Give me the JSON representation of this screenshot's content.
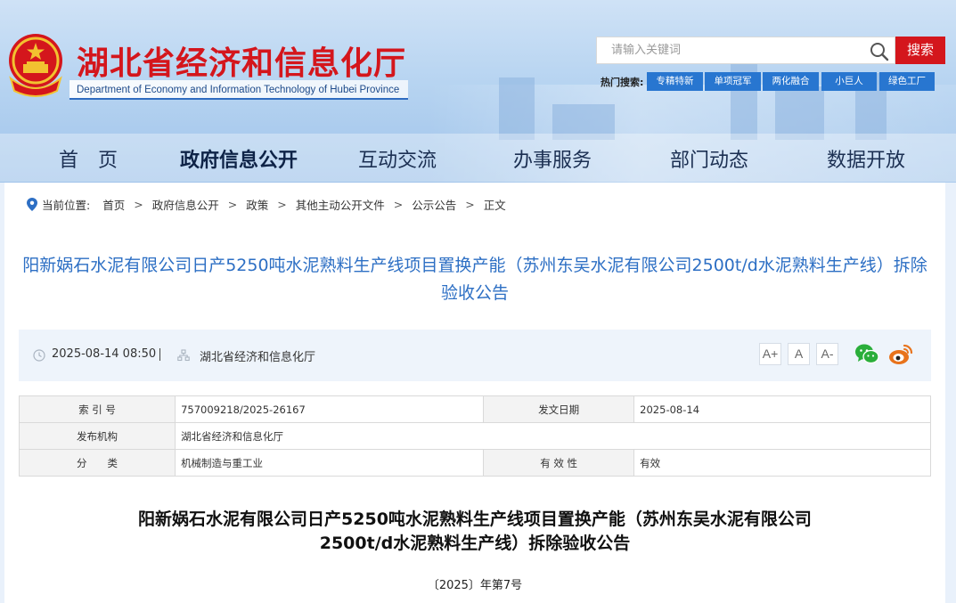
{
  "header": {
    "site_title": "湖北省经济和信息化厅",
    "site_subtitle": "Department of Economy and Information Technology of Hubei Province",
    "search_placeholder": "请输入关键词",
    "search_button": "搜索",
    "hot_search_label": "热门搜索:",
    "hot_tags": [
      "专精特新",
      "单项冠军",
      "两化融合",
      "小巨人",
      "绿色工厂"
    ]
  },
  "nav": {
    "items": [
      "首　页",
      "政府信息公开",
      "互动交流",
      "办事服务",
      "部门动态",
      "数据开放"
    ],
    "active": "政府信息公开"
  },
  "breadcrumb": {
    "label": "当前位置:",
    "items": [
      "首页",
      "政府信息公开",
      "政策",
      "其他主动公开文件",
      "公示公告",
      "正文"
    ],
    "separator": ">"
  },
  "article": {
    "title": "阳新娲石水泥有限公司日产5250吨水泥熟料生产线项目置换产能（苏州东吴水泥有限公司2500t/d水泥熟料生产线）拆除验收公告",
    "date": "2025-08-14 08:50",
    "source": "湖北省经济和信息化厅",
    "font_buttons": [
      "A+",
      "A",
      "A-"
    ],
    "doc_title_line1": "阳新娲石水泥有限公司日产5250吨水泥熟料生产线项目置换产能（苏州东吴水泥有限公司",
    "doc_title_line2": "2500t/d水泥熟料生产线）拆除验收公告",
    "doc_number": "〔2025〕年第7号"
  },
  "info_table": {
    "index_label": "索 引 号",
    "index_value": "757009218/2025-26167",
    "date_label": "发文日期",
    "date_value": "2025-08-14",
    "org_label": "发布机构",
    "org_value": "湖北省经济和信息化厅",
    "category_label": "分　　类",
    "category_value": "机械制造与重工业",
    "validity_label": "有 效 性",
    "validity_value": "有效"
  },
  "colors": {
    "brand_red": "#d4161c",
    "link_blue": "#2d6fc4",
    "tag_blue": "#2876d0",
    "wechat_green": "#2aae3a",
    "weibo_orange": "#e8731c"
  }
}
